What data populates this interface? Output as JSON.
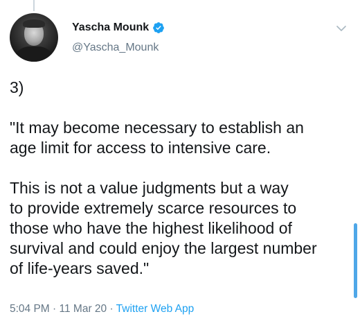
{
  "author": {
    "display_name": "Yascha Mounk",
    "handle": "@Yascha_Mounk",
    "verified": true,
    "verified_icon": "verified-badge-icon"
  },
  "tweet": {
    "text": "3)\n\n\"It may become necessary to establish an\nage limit for access to intensive care.\n\nThis is not a value judgments but a way\nto provide extremely scarce resources to\nthose who have the highest likelihood of\nsurvival and could enjoy the largest number\nof life-years saved.\""
  },
  "meta": {
    "time": "5:04 PM",
    "date": "11 Mar 20",
    "separator": " · ",
    "source": "Twitter Web App"
  },
  "menu": {
    "icon": "chevron-down-icon"
  },
  "colors": {
    "text": "#14171a",
    "secondary": "#657786",
    "accent": "#1da1f2"
  }
}
